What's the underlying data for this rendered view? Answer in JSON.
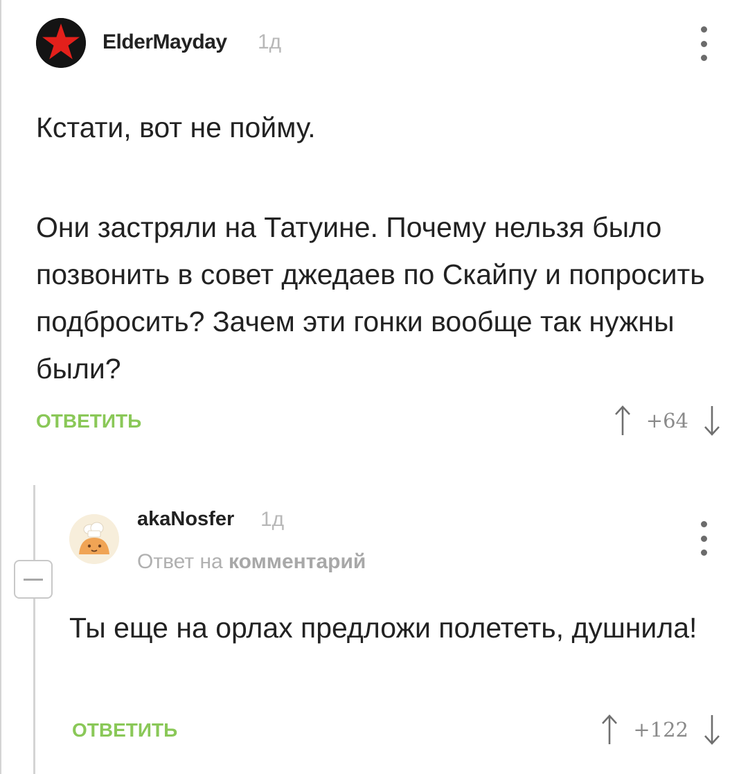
{
  "comments": [
    {
      "username": "ElderMayday",
      "time": "1д",
      "avatar_icon": "red-star-avatar-icon",
      "body": [
        "Кстати, вот не пойму.",
        "Они застряли на Татуине. Почему нельзя было позвонить в совет джедаев по Скайпу и попросить подбросить? Зачем эти гонки вообще так нужны были?"
      ],
      "reply_label": "ОТВЕТИТЬ",
      "score": "+64"
    },
    {
      "username": "akaNosfer",
      "time": "1д",
      "avatar_icon": "chef-avatar-icon",
      "reply_to_prefix": "Ответ на",
      "reply_to_link": "комментарий",
      "body": [
        "Ты еще на орлах предложи полететь, душнила!"
      ],
      "reply_label": "ОТВЕТИТЬ",
      "score": "+122"
    }
  ],
  "icons": {
    "more": "more-vertical-icon",
    "upvote": "arrow-up-icon",
    "downvote": "arrow-down-icon",
    "collapse": "minus-icon"
  },
  "colors": {
    "reply_accent": "#8ac858",
    "muted": "#b8b8b8",
    "text": "#222222"
  }
}
